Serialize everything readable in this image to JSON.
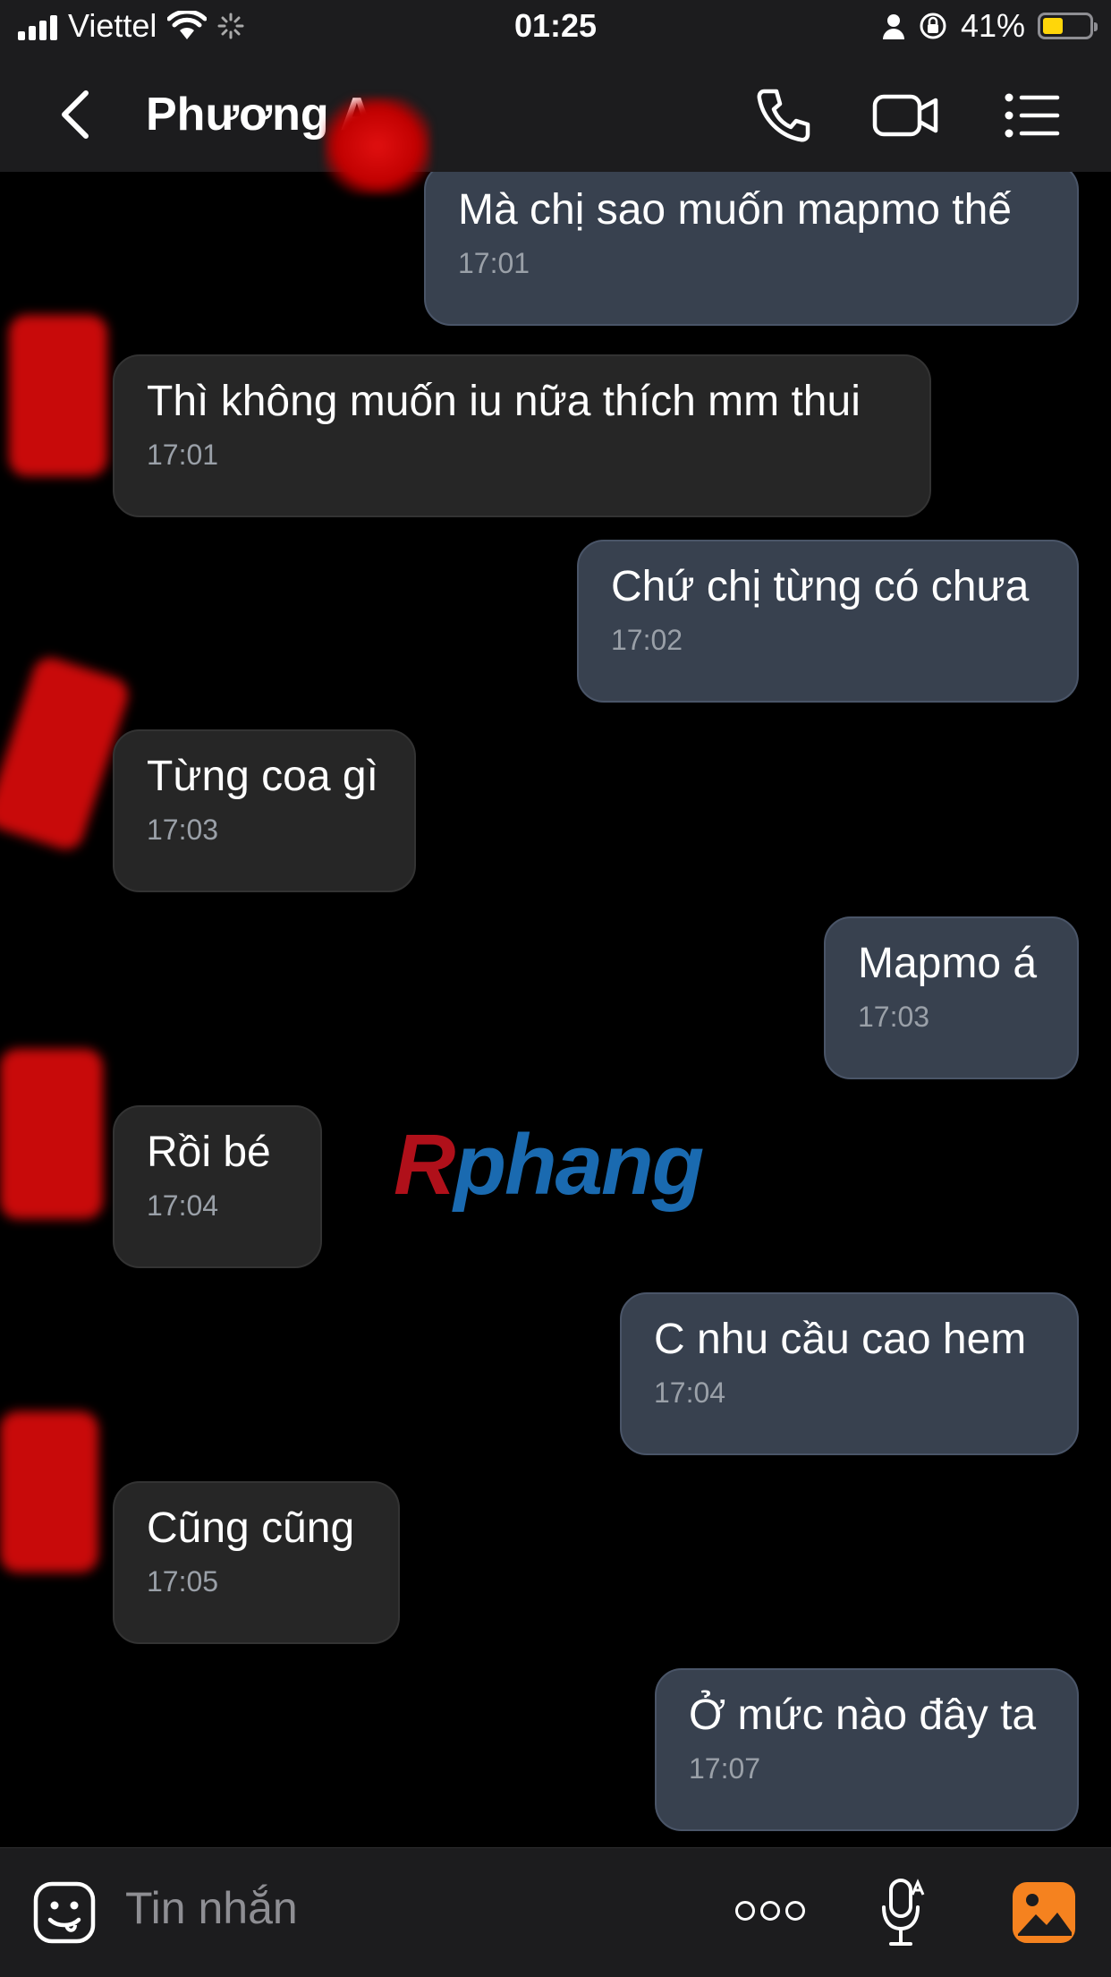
{
  "status_bar": {
    "carrier": "Viettel",
    "time": "01:25",
    "battery_percent": "41%",
    "battery_level": 0.41
  },
  "header": {
    "contact_name": "Phương A",
    "icons": [
      "back-chevron-icon",
      "phone-icon",
      "video-camera-icon",
      "list-menu-icon"
    ]
  },
  "messages": [
    {
      "direction": "outgoing",
      "text": "Mà chị sao muốn mapmo thế",
      "time": "17:01"
    },
    {
      "direction": "incoming",
      "text": "Thì không muốn iu nữa thích mm thui",
      "time": "17:01"
    },
    {
      "direction": "outgoing",
      "text": "Chứ chị từng có chưa",
      "time": "17:02"
    },
    {
      "direction": "incoming",
      "text": "Từng coa gì",
      "time": "17:03"
    },
    {
      "direction": "outgoing",
      "text": "Mapmo á",
      "time": "17:03"
    },
    {
      "direction": "incoming",
      "text": "Rồi bé",
      "time": "17:04"
    },
    {
      "direction": "outgoing",
      "text": "C nhu cầu cao hem",
      "time": "17:04"
    },
    {
      "direction": "incoming",
      "text": "Cũng cũng",
      "time": "17:05"
    },
    {
      "direction": "outgoing",
      "text": "Ở mức nào đây ta",
      "time": "17:07"
    }
  ],
  "watermark": {
    "first": "R",
    "rest": "phang"
  },
  "input_bar": {
    "placeholder": "Tin nhắn",
    "icons": [
      "sticker-emoji-icon",
      "more-options-icon",
      "voice-mic-icon",
      "photo-gallery-icon"
    ]
  },
  "colors": {
    "background": "#000000",
    "bar_background": "#1c1c1e",
    "outgoing_bubble": "#38414f",
    "incoming_bubble": "#262626",
    "timestamp": "#9aa0a8",
    "battery_fill": "#ffd60a",
    "photo_icon": "#f5821f"
  }
}
